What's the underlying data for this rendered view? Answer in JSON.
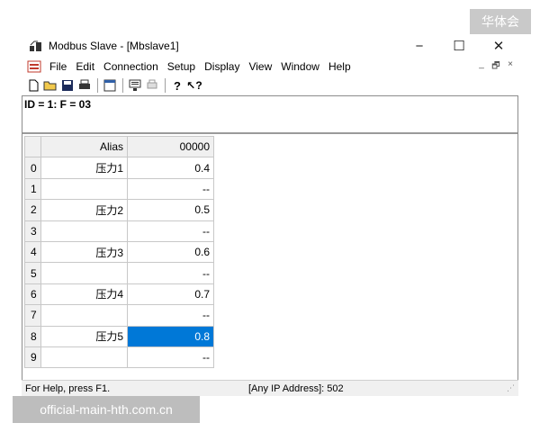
{
  "watermark_top": "华体会",
  "watermark_bottom": "official-main-hth.com.cn",
  "window": {
    "title": "Modbus Slave - [Mbslave1]",
    "controls": {
      "minimize": "−",
      "maximize": "☐",
      "close": "✕"
    }
  },
  "menu": {
    "items": [
      "File",
      "Edit",
      "Connection",
      "Setup",
      "Display",
      "View",
      "Window",
      "Help"
    ],
    "mdi": {
      "minimize": "_",
      "restore": "🗗",
      "close": "×"
    }
  },
  "toolbar": {
    "buttons": [
      "new-icon",
      "open-icon",
      "save-icon",
      "print-icon",
      "window-icon",
      "monitor-icon",
      "printer-icon",
      "help-icon",
      "context-help-icon"
    ]
  },
  "doc": {
    "id_line": "ID = 1: F = 03",
    "grid": {
      "headers": [
        "Alias",
        "00000"
      ],
      "rows": [
        {
          "index": "0",
          "alias": "压力1",
          "value": "0.4"
        },
        {
          "index": "1",
          "alias": "",
          "value": "--"
        },
        {
          "index": "2",
          "alias": "压力2",
          "value": "0.5"
        },
        {
          "index": "3",
          "alias": "",
          "value": "--"
        },
        {
          "index": "4",
          "alias": "压力3",
          "value": "0.6"
        },
        {
          "index": "5",
          "alias": "",
          "value": "--"
        },
        {
          "index": "6",
          "alias": "压力4",
          "value": "0.7"
        },
        {
          "index": "7",
          "alias": "",
          "value": "--"
        },
        {
          "index": "8",
          "alias": "压力5",
          "value": "0.8"
        },
        {
          "index": "9",
          "alias": "",
          "value": "--"
        }
      ],
      "selected_row": 8
    }
  },
  "status": {
    "help": "For Help, press F1.",
    "ip": "[Any IP Address]: 502"
  },
  "colors": {
    "selection": "#0078d7"
  }
}
